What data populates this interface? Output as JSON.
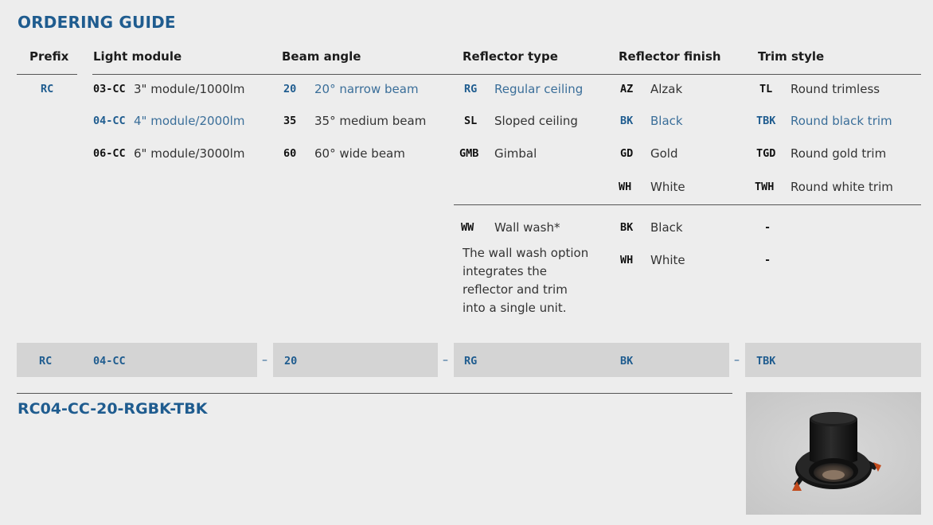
{
  "title": "ORDERING GUIDE",
  "headers": {
    "prefix": "Prefix",
    "light_module": "Light module",
    "beam_angle": "Beam angle",
    "reflector_type": "Reflector type",
    "reflector_finish": "Reflector finish",
    "trim_style": "Trim style"
  },
  "prefix": {
    "code": "RC"
  },
  "light_module": [
    {
      "code": "03-CC",
      "desc": "3\" module/1000lm",
      "selected": false
    },
    {
      "code": "04-CC",
      "desc": "4\" module/2000lm",
      "selected": true
    },
    {
      "code": "06-CC",
      "desc": "6\" module/3000lm",
      "selected": false
    }
  ],
  "beam_angle": [
    {
      "code": "20",
      "desc": "20° narrow beam",
      "selected": true
    },
    {
      "code": "35",
      "desc": "35° medium beam",
      "selected": false
    },
    {
      "code": "60",
      "desc": "60° wide beam",
      "selected": false
    }
  ],
  "reflector_type": [
    {
      "code": "RG",
      "desc": "Regular ceiling",
      "selected": true
    },
    {
      "code": "SL",
      "desc": "Sloped ceiling",
      "selected": false
    },
    {
      "code": "GMB",
      "desc": "Gimbal",
      "selected": false
    }
  ],
  "reflector_finish": [
    {
      "code": "AZ",
      "desc": "Alzak",
      "selected": false
    },
    {
      "code": "BK",
      "desc": "Black",
      "selected": true
    },
    {
      "code": "GD",
      "desc": "Gold",
      "selected": false
    },
    {
      "code": "WH",
      "desc": "White",
      "selected": false
    }
  ],
  "trim_style": [
    {
      "code": "TL",
      "desc": "Round trimless",
      "selected": false
    },
    {
      "code": "TBK",
      "desc": "Round black trim",
      "selected": true
    },
    {
      "code": "TGD",
      "desc": "Round gold trim",
      "selected": false
    },
    {
      "code": "TWH",
      "desc": "Round white trim",
      "selected": false
    }
  ],
  "wall_wash": {
    "code": "WW",
    "desc": "Wall wash*",
    "note": "The wall wash option integrates the reflector and trim into a single unit.",
    "finishes": [
      {
        "code": "BK",
        "desc": "Black",
        "trim": "-"
      },
      {
        "code": "WH",
        "desc": "White",
        "trim": "-"
      }
    ]
  },
  "example": {
    "prefix": "RC",
    "module": "04-CC",
    "beam": "20",
    "reflector": "RG",
    "finish": "BK",
    "trim": "TBK",
    "dash": "–",
    "result": "RC04-CC-20-RGBK-TBK"
  },
  "colors": {
    "accent": "#1f5c8f",
    "band": "#d4d4d4",
    "background": "#ededed"
  },
  "product_image": {
    "icon": "recessed-downlight-photo"
  }
}
